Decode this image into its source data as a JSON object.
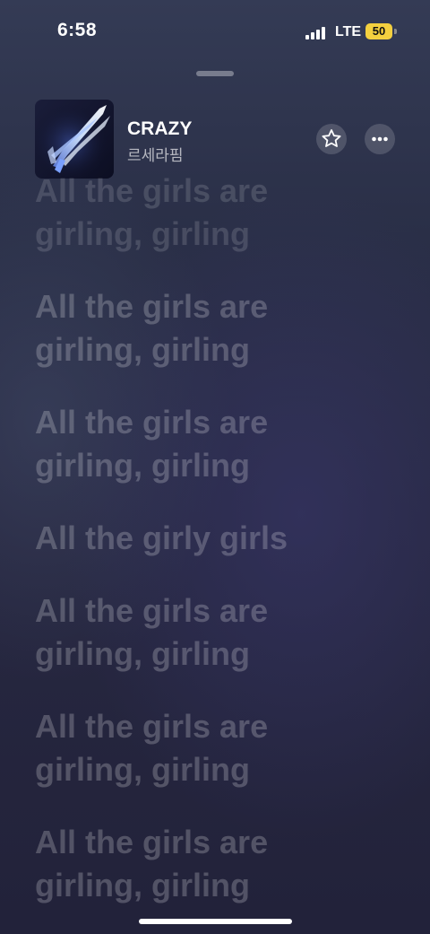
{
  "status_bar": {
    "time": "6:58",
    "network": "LTE",
    "battery": "50",
    "battery_color": "#f4d03f"
  },
  "now_playing": {
    "title": "CRAZY",
    "artist": "르세라핌",
    "favorite_icon": "star-icon",
    "more_icon": "ellipsis-icon"
  },
  "lyrics": [
    [
      "All the girls are",
      "girling, girling"
    ],
    [
      "All the girls are",
      "girling, girling"
    ],
    [
      "All the girls are",
      "girling, girling"
    ],
    [
      "All the girly girls"
    ],
    [
      "All the girls are",
      "girling, girling"
    ],
    [
      "All the girls are",
      "girling, girling"
    ],
    [
      "All the girls are",
      "girling, girling"
    ]
  ]
}
